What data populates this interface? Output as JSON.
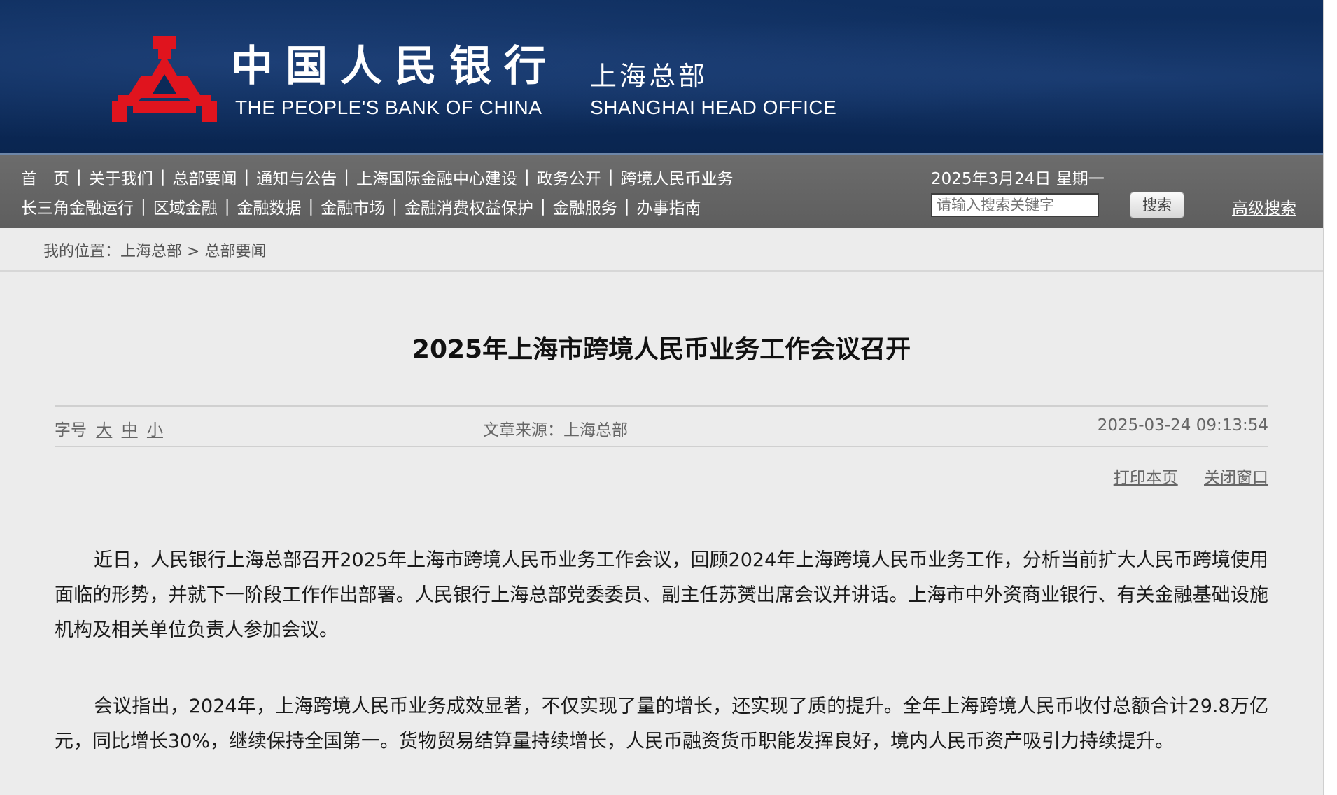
{
  "header": {
    "bank_name_cn": "中国人民银行",
    "bank_name_en": "THE PEOPLE'S BANK OF CHINA",
    "office_cn": "上海总部",
    "office_en": "SHANGHAI HEAD OFFICE",
    "logo_icon": "pboc-logo-icon",
    "colors": {
      "banner": "#0b2a58",
      "logo": "#e0141e"
    }
  },
  "nav": {
    "row1": [
      "首　页",
      "关于我们",
      "总部要闻",
      "通知与公告",
      "上海国际金融中心建设",
      "政务公开",
      "跨境人民币业务"
    ],
    "row2": [
      "长三角金融运行",
      "区域金融",
      "金融数据",
      "金融市场",
      "金融消费权益保护",
      "金融服务",
      "办事指南"
    ],
    "separator": "|",
    "date": "2025年3月24日 星期一",
    "search_placeholder": "请输入搜索关键字",
    "search_button": "搜索",
    "advanced_search": "高级搜索"
  },
  "breadcrumb": {
    "label": "我的位置：",
    "items": [
      "上海总部",
      "总部要闻"
    ],
    "separator": " > "
  },
  "article": {
    "title": "2025年上海市跨境人民币业务工作会议召开",
    "font_size_label": "字号",
    "font_sizes": [
      "大",
      "中",
      "小"
    ],
    "source_label": "文章来源：",
    "source": "上海总部",
    "published": "2025-03-24 09:13:54",
    "print": "打印本页",
    "close": "关闭窗口",
    "paragraphs": [
      "近日，人民银行上海总部召开2025年上海市跨境人民币业务工作会议，回顾2024年上海跨境人民币业务工作，分析当前扩大人民币跨境使用面临的形势，并就下一阶段工作作出部署。人民银行上海总部党委委员、副主任苏赟出席会议并讲话。上海市中外资商业银行、有关金融基础设施机构及相关单位负责人参加会议。",
      "会议指出，2024年，上海跨境人民币业务成效显著，不仅实现了量的增长，还实现了质的提升。全年上海跨境人民币收付总额合计29.8万亿元，同比增长30%，继续保持全国第一。货物贸易结算量持续增长，人民币融资货币职能发挥良好，境内人民币资产吸引力持续提升。"
    ]
  }
}
